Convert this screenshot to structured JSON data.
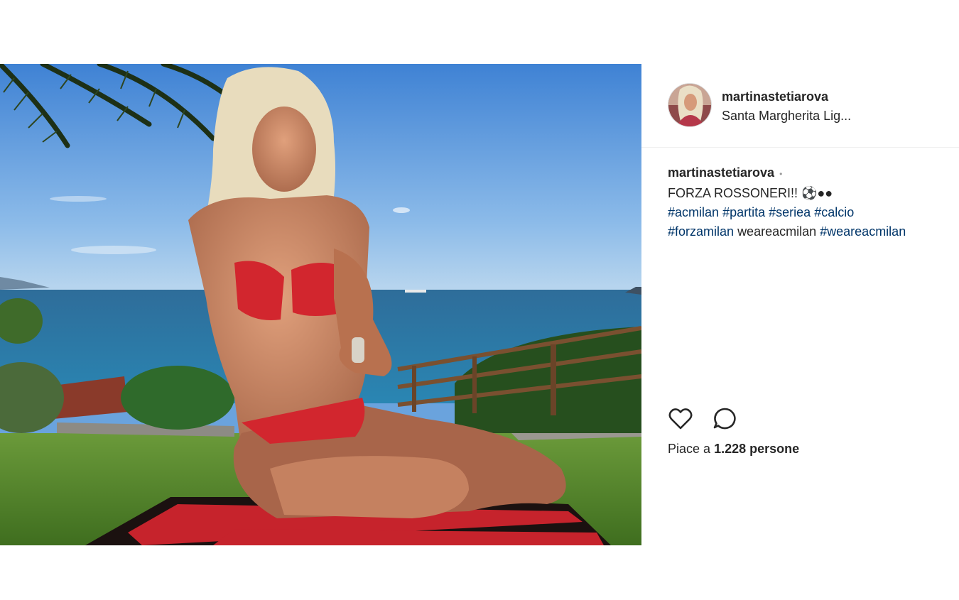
{
  "post": {
    "username": "martinastetiarova",
    "location": "Santa Margherita Lig...",
    "caption": {
      "username": "martinastetiarova",
      "dot": "•",
      "text": "FORZA ROSSONERI!! ⚽●●",
      "hashtags_line1": [
        "#acmilan",
        "#partita",
        "#seriea",
        "#calcio"
      ],
      "line2_tag1": "#forzamilan",
      "line2_plain": "weareacmilan",
      "line2_tag2": "#weareacmilan"
    },
    "likes_prefix": "Piace a",
    "likes_count": "1.228",
    "likes_suffix": "persone",
    "icons": {
      "like": "heart-icon",
      "comment": "comment-icon"
    }
  },
  "colors": {
    "link": "#003569",
    "text": "#262626",
    "divider": "#efefef"
  }
}
